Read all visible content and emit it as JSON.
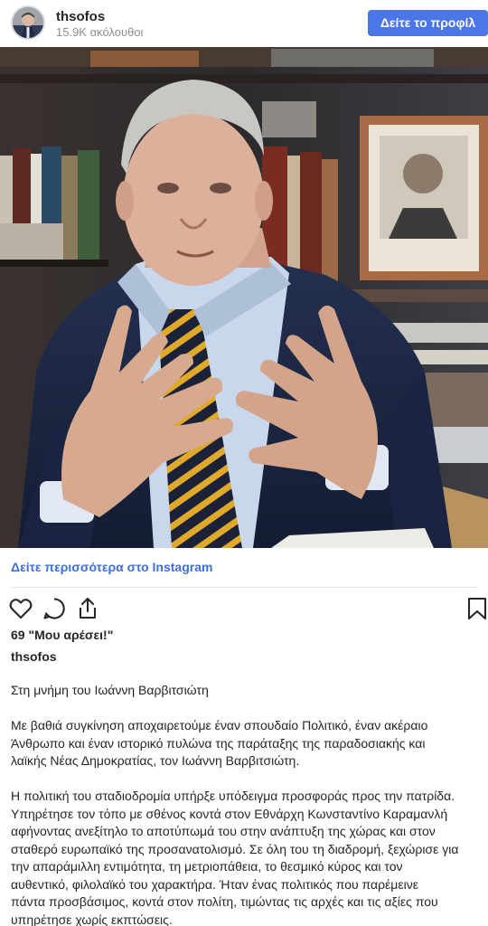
{
  "header": {
    "username": "thsofos",
    "followers": "15.9K ακόλουθοι",
    "view_profile_label": "Δείτε το προφίλ"
  },
  "post": {
    "photo_alt": "photo",
    "see_more_label": "Δείτε περισσότερα στο Instagram",
    "likes": "69 \"Μου αρέσει!\"",
    "caption_user": "thsofos",
    "caption": {
      "p1": [
        "Στη μνήμη του Ιωάννη Βαρβιτσιώτη"
      ],
      "p2": [
        "Με βαθιά συγκίνηση αποχαιρετούμε έναν σπουδαίο Πολιτικό, έναν ακέραιο",
        "Άνθρωπο και έναν ιστορικό πυλώνα της παράταξης της παραδοσιακής και",
        "λαϊκής Νέας Δημοκρατίας, τον Ιωάννη Βαρβιτσιώτη."
      ],
      "p3": [
        "Η πολιτική του σταδιοδρομία υπήρξε υπόδειγμα προσφοράς προς την πατρίδα.",
        "Υπηρέτησε τον τόπο με σθένος κοντά στον Εθνάρχη Κωνσταντίνο Καραμανλή",
        "αφήνοντας ανεξίτηλο το αποτύπωμά του στην ανάπτυξη της χώρας και στον",
        "σταθερό ευρωπαϊκό της προσανατολισμό. Σε όλη του τη διαδρομή, ξεχώρισε για",
        "την απαράμιλλη εντιμότητα, τη μετριοπάθεια, το θεσμικό κύρος και τον",
        "αυθεντικό, φιλολαϊκό του χαρακτήρα. Ήταν ένας πολιτικός που παρέμεινε",
        "πάντα προσβάσιμος, κοντά στον πολίτη, τιμώντας τις αρχές και τις αξίες που",
        "υπηρέτησε χωρίς εκπτώσεις."
      ]
    }
  },
  "icons": {
    "like": "heart-icon",
    "comment": "comment-icon",
    "share": "share-icon",
    "save": "bookmark-icon"
  },
  "colors": {
    "accent": "#4a76e8",
    "link": "#3d6fe0",
    "text": "#262626",
    "muted": "#8e8e8e"
  }
}
